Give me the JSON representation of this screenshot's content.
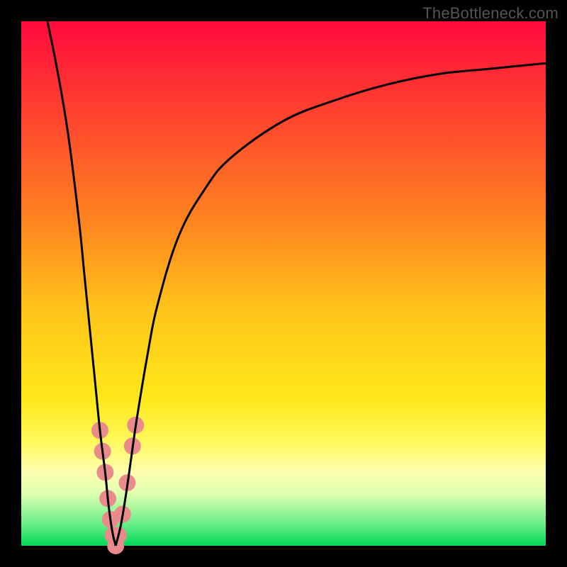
{
  "watermark": "TheBottleneck.com",
  "chart_data": {
    "type": "line",
    "title": "",
    "xlabel": "",
    "ylabel": "",
    "xlim": [
      0,
      100
    ],
    "ylim": [
      0,
      100
    ],
    "grid": false,
    "legend": false,
    "gradient_stops": [
      {
        "offset": 0.0,
        "color": "#ff0a3c"
      },
      {
        "offset": 0.2,
        "color": "#ff4a2d"
      },
      {
        "offset": 0.4,
        "color": "#ff8a1e"
      },
      {
        "offset": 0.55,
        "color": "#ffc41a"
      },
      {
        "offset": 0.72,
        "color": "#ffe81a"
      },
      {
        "offset": 0.8,
        "color": "#fff85a"
      },
      {
        "offset": 0.86,
        "color": "#ffffb0"
      },
      {
        "offset": 0.9,
        "color": "#dfffb0"
      },
      {
        "offset": 0.96,
        "color": "#66ee88"
      },
      {
        "offset": 1.0,
        "color": "#00d858"
      }
    ],
    "series": [
      {
        "name": "left-branch",
        "color": "#000000",
        "x": [
          5,
          7,
          9,
          11,
          12,
          13,
          14,
          15,
          16,
          16.5,
          17,
          17.5,
          18
        ],
        "y": [
          100,
          90,
          78,
          62,
          52,
          42,
          32,
          22,
          14,
          9,
          5,
          2,
          0
        ]
      },
      {
        "name": "right-branch",
        "color": "#000000",
        "x": [
          18,
          19,
          20,
          21,
          22,
          24,
          26,
          30,
          35,
          40,
          50,
          60,
          70,
          80,
          90,
          100
        ],
        "y": [
          0,
          4,
          10,
          17,
          24,
          36,
          46,
          59,
          68,
          74,
          81,
          85,
          88,
          90,
          91,
          92
        ]
      }
    ],
    "markers": {
      "name": "scatter-points",
      "color": "#e98b8b",
      "radius": 12,
      "points": [
        {
          "x": 15.0,
          "y": 22
        },
        {
          "x": 15.5,
          "y": 18
        },
        {
          "x": 16.0,
          "y": 14
        },
        {
          "x": 16.5,
          "y": 9
        },
        {
          "x": 17.0,
          "y": 5
        },
        {
          "x": 17.5,
          "y": 2
        },
        {
          "x": 18.0,
          "y": 0
        },
        {
          "x": 18.5,
          "y": 2
        },
        {
          "x": 19.3,
          "y": 6
        },
        {
          "x": 20.2,
          "y": 12
        },
        {
          "x": 21.2,
          "y": 19
        },
        {
          "x": 21.8,
          "y": 23
        }
      ]
    }
  }
}
